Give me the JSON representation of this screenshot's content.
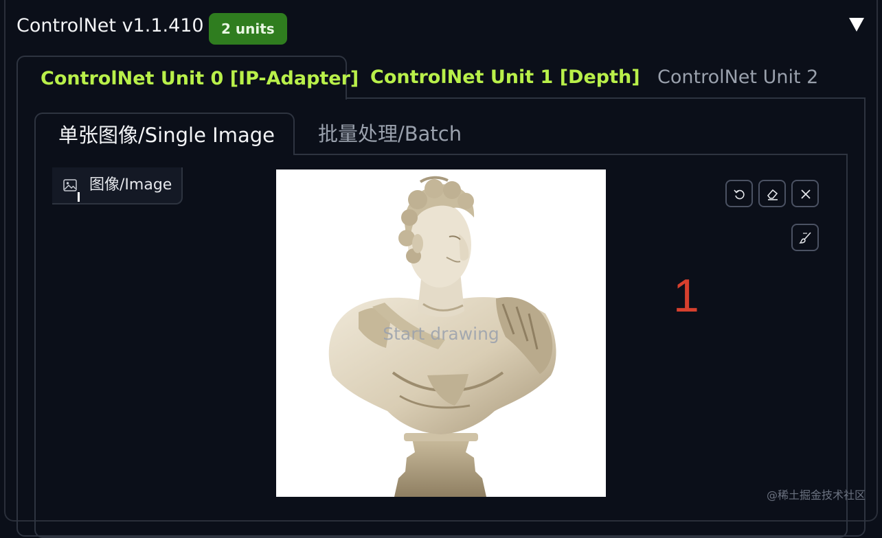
{
  "header": {
    "title": "ControlNet v1.1.410",
    "units_badge": "2 units",
    "collapse_icon": "triangle-down-icon"
  },
  "unit_tabs": [
    {
      "label": "ControlNet Unit 0 [IP-Adapter]",
      "active": true,
      "color": "#b9f04a"
    },
    {
      "label": "ControlNet Unit 1 [Depth]",
      "active": false,
      "color": "#b9f04a"
    },
    {
      "label": "ControlNet Unit 2",
      "active": false,
      "color": "#9aa1ad"
    }
  ],
  "mode_tabs": [
    {
      "label": "单张图像/Single Image",
      "active": true
    },
    {
      "label": "批量处理/Batch",
      "active": false
    }
  ],
  "image_input": {
    "label": "图像/Image",
    "icon": "image-icon",
    "canvas_hint": "Start drawing"
  },
  "tools": [
    {
      "name": "undo-icon"
    },
    {
      "name": "eraser-icon"
    },
    {
      "name": "close-icon"
    },
    {
      "name": "brush-icon"
    }
  ],
  "annotation": {
    "number": "1"
  },
  "watermark": "@稀土掘金技术社区",
  "colors": {
    "background": "#0b0f19",
    "badge": "#2f7d1f",
    "active_tab_text": "#b9f04a",
    "annotation": "#d6402e"
  }
}
